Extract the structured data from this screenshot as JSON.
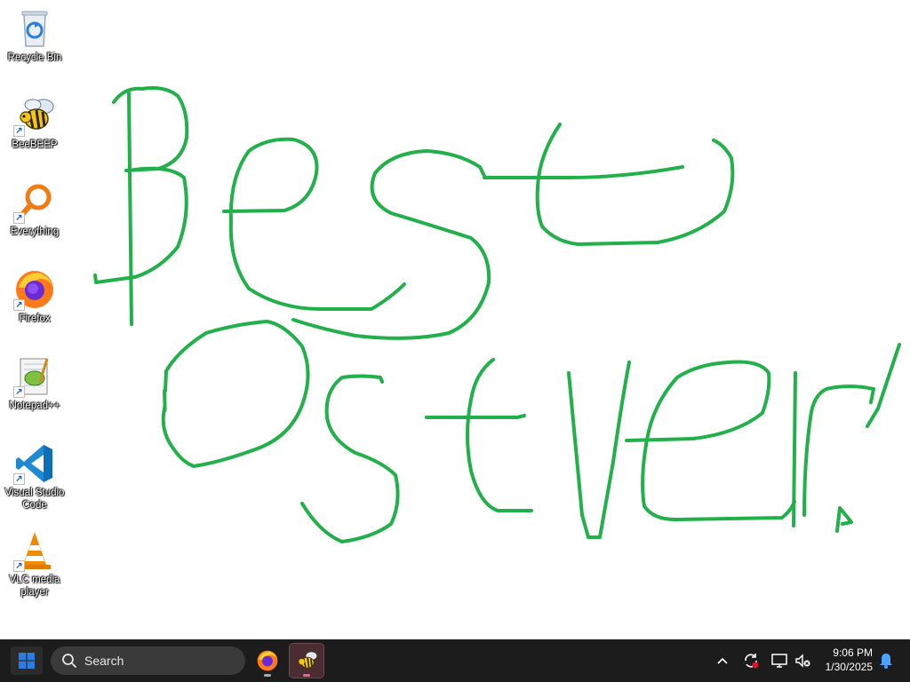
{
  "desktop": {
    "icons": [
      {
        "name": "recycle-bin",
        "label": "Recycle Bin",
        "shortcut": false
      },
      {
        "name": "beebeep",
        "label": "BeeBEEP",
        "shortcut": true
      },
      {
        "name": "everything",
        "label": "Everything",
        "shortcut": true
      },
      {
        "name": "firefox",
        "label": "Firefox",
        "shortcut": true
      },
      {
        "name": "notepad-plus-plus",
        "label": "Notepad++",
        "shortcut": true
      },
      {
        "name": "visual-studio-code",
        "label": "Visual Studio Code",
        "shortcut": true
      },
      {
        "name": "vlc-media-player",
        "label": "VLC media player",
        "shortcut": true
      }
    ],
    "drawing": {
      "description_words": [
        "Best",
        "OS",
        "ever!"
      ],
      "stroke_color": "#22b04a"
    }
  },
  "taskbar": {
    "search_label": "Search",
    "pinned": [
      {
        "name": "firefox",
        "running": true,
        "active": false
      },
      {
        "name": "beebeep",
        "running": true,
        "active": true
      }
    ],
    "tray_icons": [
      "chevron-up-icon",
      "sync-icon",
      "network-icon",
      "volume-muted-icon"
    ],
    "clock": {
      "time": "9:06 PM",
      "date": "1/30/2025"
    },
    "accent_color": "#2a7de1"
  }
}
